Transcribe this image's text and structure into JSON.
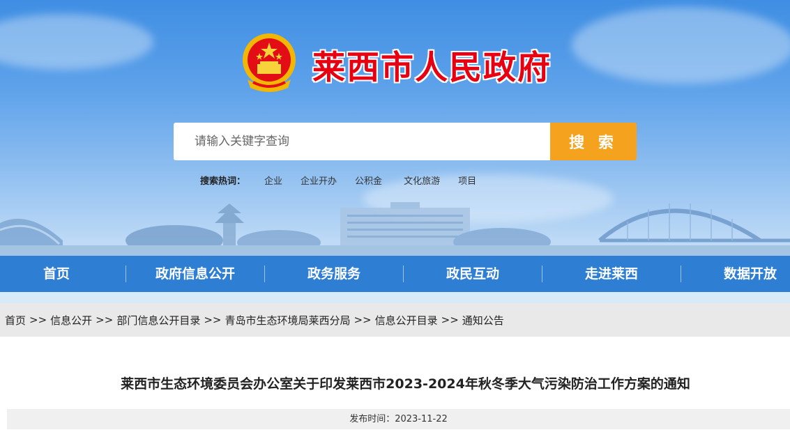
{
  "header": {
    "site_title": "莱西市人民政府",
    "search": {
      "placeholder": "请输入关键字查询",
      "button_label": "搜 索"
    },
    "hot_search": {
      "label": "搜索热词：",
      "terms": [
        "企业",
        "企业开办",
        "公积金",
        "文化旅游",
        "项目"
      ]
    }
  },
  "nav": {
    "items": [
      "首页",
      "政府信息公开",
      "政务服务",
      "政民互动",
      "走进莱西",
      "数据开放"
    ]
  },
  "breadcrumb": {
    "items": [
      "首页",
      "信息公开",
      "部门信息公开目录",
      "青岛市生态环境局莱西分局",
      "信息公开目录",
      "通知公告"
    ],
    "separator": ">>"
  },
  "article": {
    "title": "莱西市生态环境委员会办公室关于印发莱西市2023-2024年秋冬季大气污染防治工作方案的通知",
    "publish_label": "发布时间：",
    "publish_date": "2023-11-22"
  },
  "colors": {
    "title_red": "#e60012",
    "nav_blue": "#2e7ed4",
    "search_orange": "#f5a21e"
  }
}
